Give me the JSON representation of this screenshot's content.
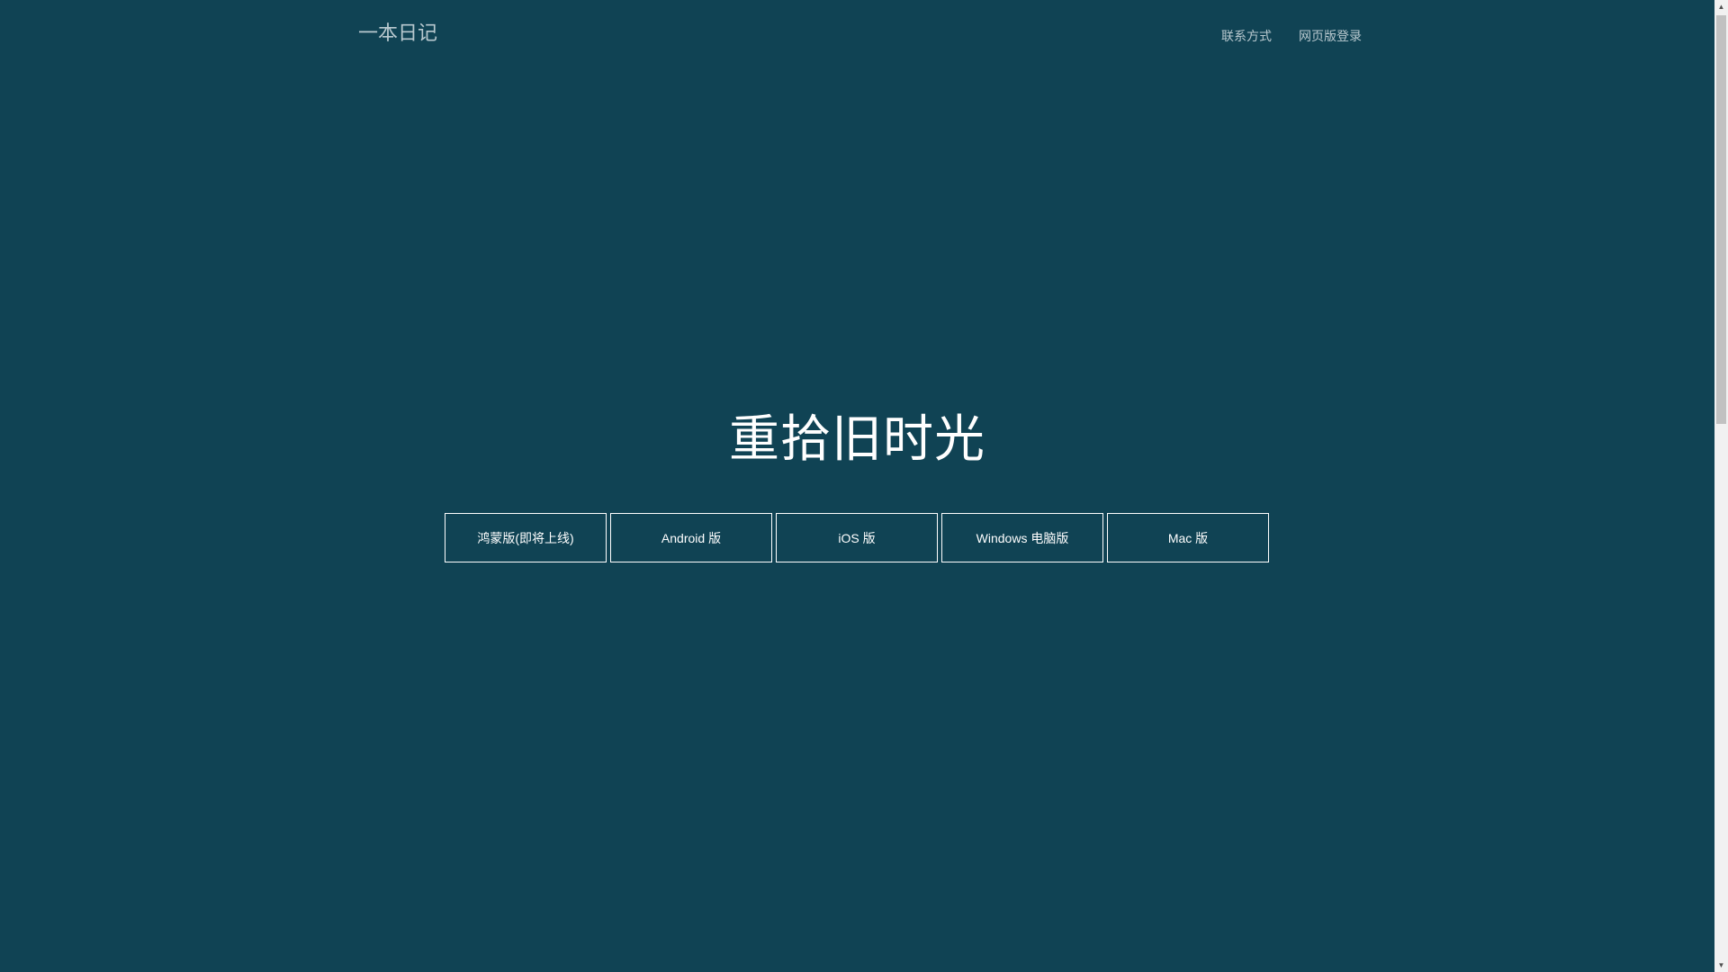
{
  "nav": {
    "brand": "一本日记",
    "links": [
      "联系方式",
      "网页版登录"
    ]
  },
  "hero": {
    "title": "重拾旧时光"
  },
  "downloads": [
    "鸿蒙版(即将上线)",
    "Android 版",
    "iOS 版",
    "Windows 电脑版",
    "Mac 版"
  ],
  "scrollbar": {
    "up_glyph": "▲",
    "down_glyph": "▼"
  },
  "colors": {
    "background": "#104354",
    "nav_text": "#b9c9cf",
    "hero_text": "#ffffff"
  }
}
